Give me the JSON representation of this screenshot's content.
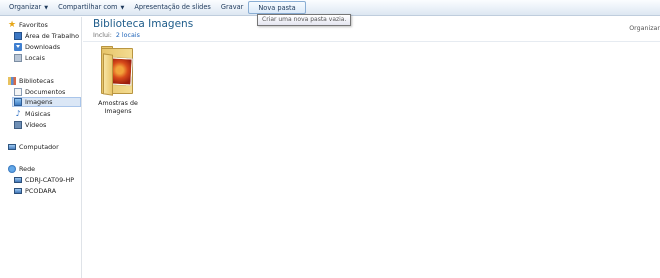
{
  "toolbar": {
    "organize_label": "Organizar",
    "share_label": "Compartilhar com",
    "slideshow_label": "Apresentação de slides",
    "burn_label": "Gravar",
    "new_folder_label": "Nova pasta"
  },
  "tooltip": {
    "text": "Criar uma nova pasta vazia."
  },
  "nav": {
    "favorites": {
      "label": "Favoritos",
      "items": [
        {
          "label": "Área de Trabalho",
          "icon": "desktop-icon"
        },
        {
          "label": "Downloads",
          "icon": "downloads-icon"
        },
        {
          "label": "Locais",
          "icon": "recent-places-icon"
        }
      ]
    },
    "libraries": {
      "label": "Bibliotecas",
      "items": [
        {
          "label": "Documentos",
          "icon": "documents-icon"
        },
        {
          "label": "Imagens",
          "icon": "pictures-icon",
          "selected": true
        },
        {
          "label": "Músicas",
          "icon": "music-icon"
        },
        {
          "label": "Vídeos",
          "icon": "videos-icon"
        }
      ]
    },
    "computer": {
      "label": "Computador"
    },
    "network": {
      "label": "Rede",
      "items": [
        {
          "label": "CDRJ-CAT09-HP",
          "icon": "computer-icon"
        },
        {
          "label": "PCODARA",
          "icon": "computer-icon"
        }
      ]
    }
  },
  "content": {
    "title": "Biblioteca Imagens",
    "includes_label": "Inclui:",
    "locations_link": "2 locais",
    "arrange_label": "Organizar",
    "folder": {
      "label": "Amostras de Imagens",
      "icon": "picture-folder-icon"
    }
  },
  "colors": {
    "toolbar_text": "#1e395b",
    "title": "#1e5c8a",
    "link": "#1e63b8",
    "selection": "#dbe7f6"
  }
}
